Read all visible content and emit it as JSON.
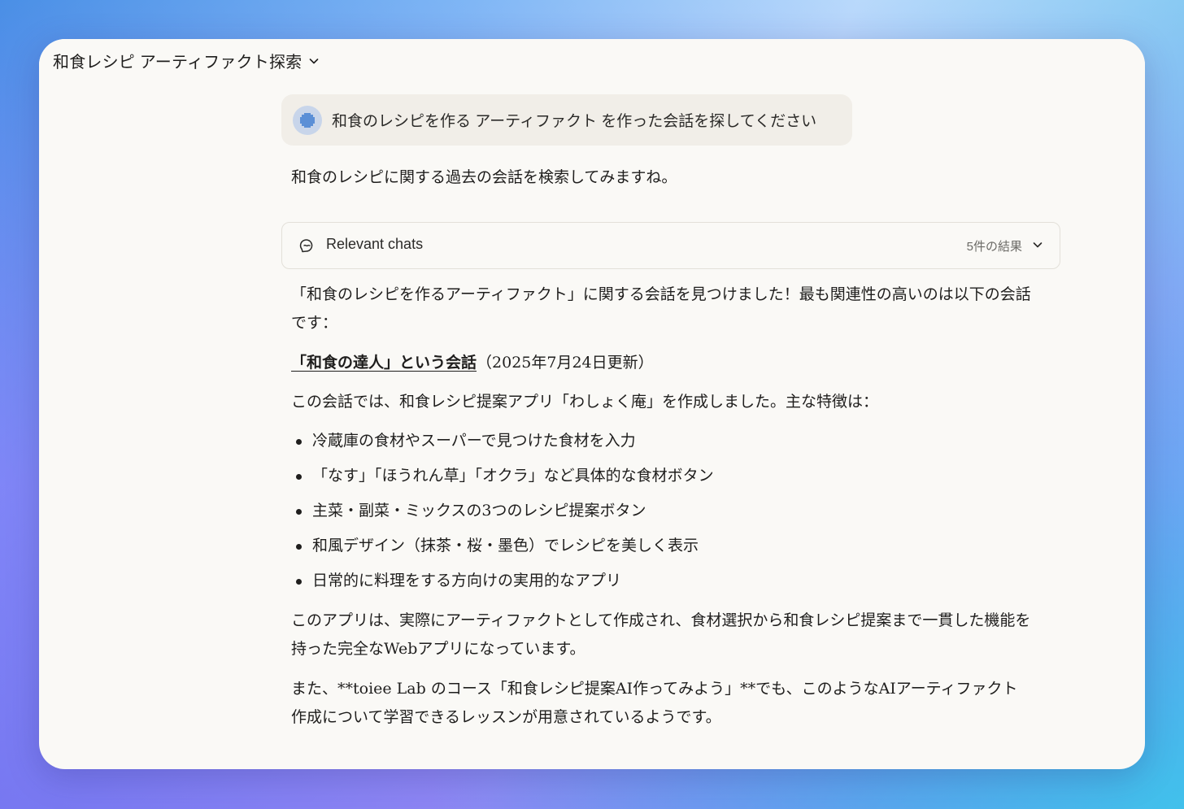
{
  "header": {
    "title": "和食レシピ アーティファクト探索"
  },
  "user_message": {
    "text": "和食のレシピを作る アーティファクト を作った会話を探してください"
  },
  "assistant": {
    "intro": "和食のレシピに関する過去の会話を検索してみますね。",
    "tool": {
      "label": "Relevant chats",
      "count": "5件の結果"
    },
    "p1": "「和食のレシピを作るアーティファクト」に関する会話を見つけました！最も関連性の高いのは以下の会話です：",
    "chat_link": "「和食の達人」という会話",
    "chat_date": "（2025年7月24日更新）",
    "p3": "この会話では、和食レシピ提案アプリ「わしょく庵」を作成しました。主な特徴は：",
    "features": [
      "冷蔵庫の食材やスーパーで見つけた食材を入力",
      "「なす」「ほうれん草」「オクラ」など具体的な食材ボタン",
      "主菜・副菜・ミックスの3つのレシピ提案ボタン",
      "和風デザイン（抹茶・桜・墨色）でレシピを美しく表示",
      "日常的に料理をする方向けの実用的なアプリ"
    ],
    "p4": "このアプリは、実際にアーティファクトとして作成され、食材選択から和食レシピ提案まで一貫した機能を持った完全なWebアプリになっています。",
    "p5": "また、**toiee Lab のコース「和食レシピ提案AI作ってみよう」**でも、このようなAIアーティファクト作成について学習できるレッスンが用意されているようです。"
  },
  "icons": {
    "title_chevron": "chevron-down-icon",
    "avatar": "user-avatar-icon",
    "tool": "chat-search-icon",
    "tool_chevron": "chevron-down-icon"
  },
  "colors": {
    "window_bg": "#faf9f6",
    "bubble_bg": "#f1eee8",
    "text": "#1f1e1d",
    "avatar_bg": "#c8d5ea",
    "avatar_fg": "#5b8fd6"
  }
}
